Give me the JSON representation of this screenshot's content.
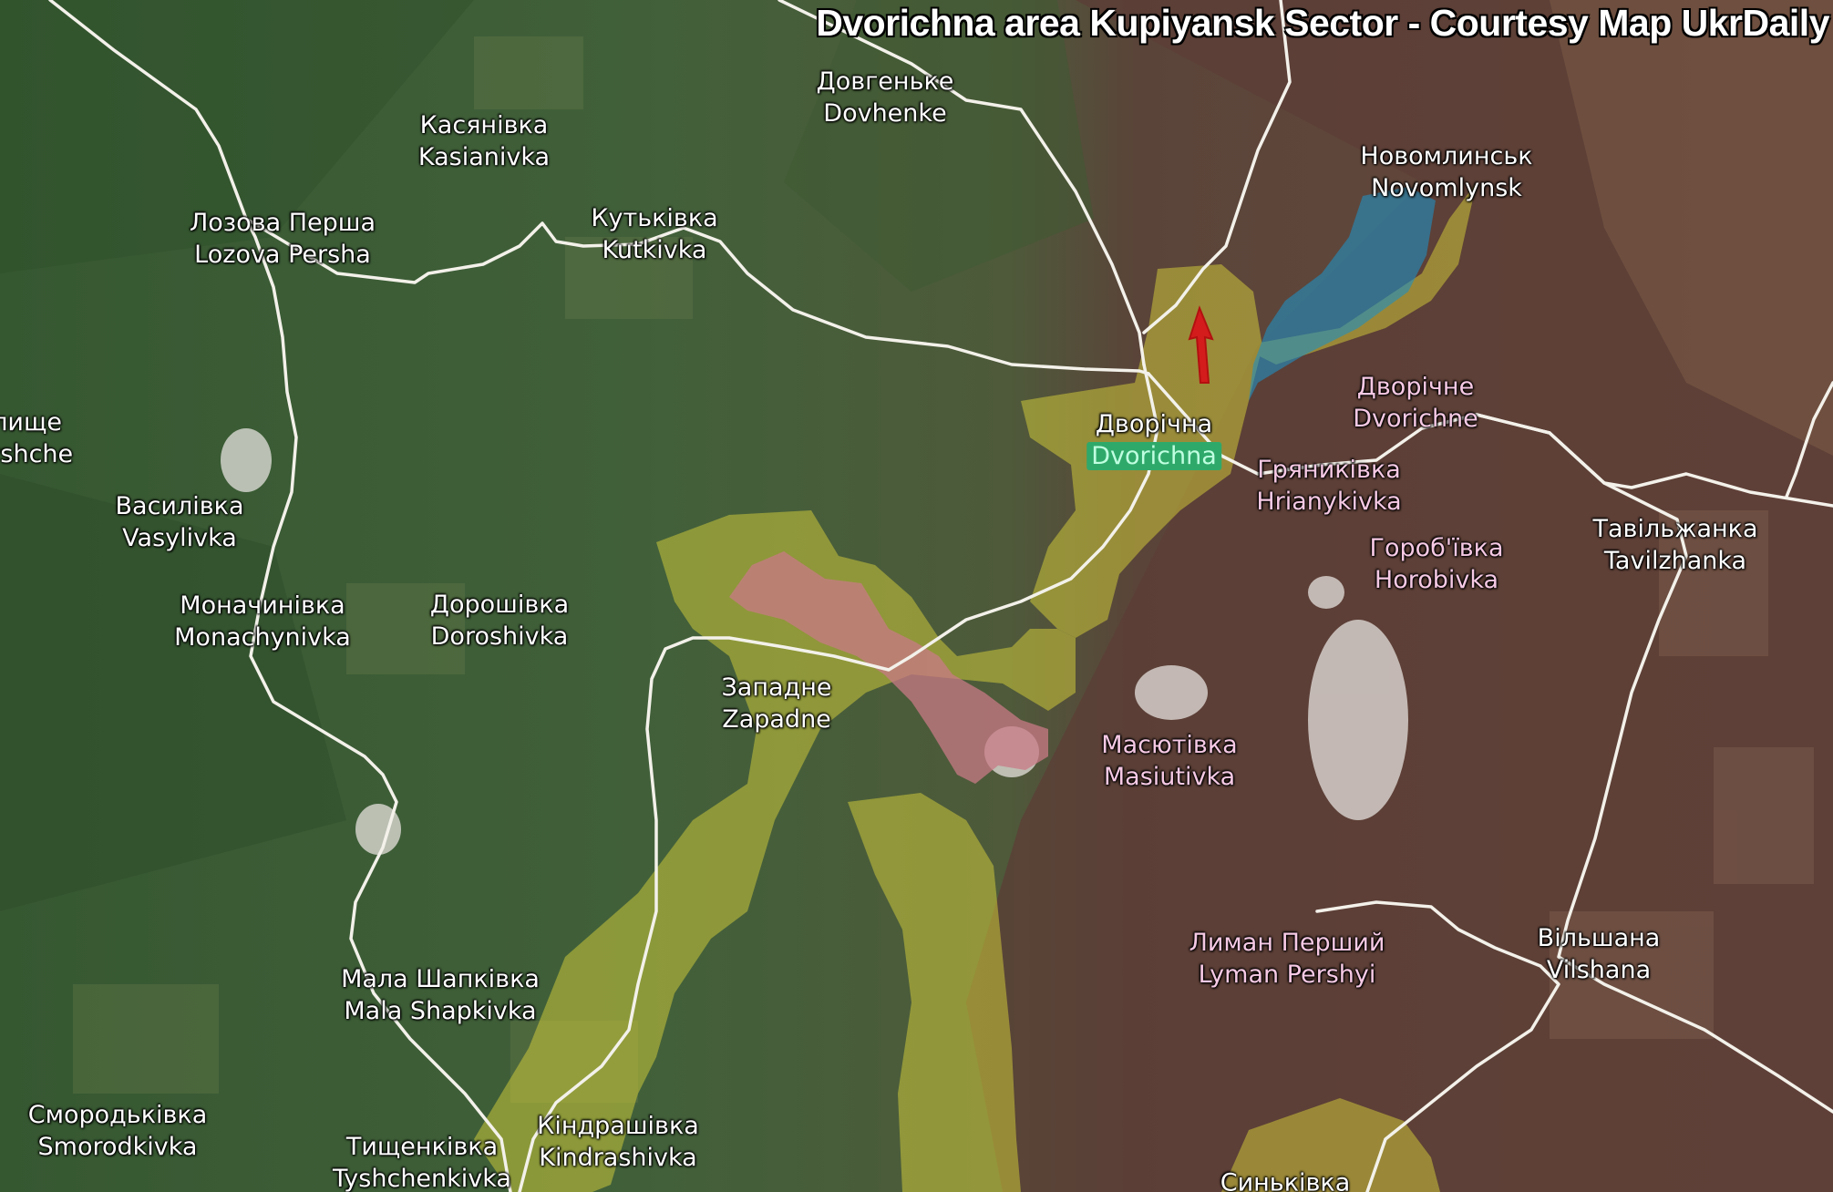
{
  "map": {
    "title": "Dvorichna area Kupiyansk Sector - Courtesy Map UkrDaily",
    "colors": {
      "road": "#f3f1ea",
      "russian_control": "#c87a86",
      "contested": "#d8d23a",
      "river": "#1f8fc1",
      "advance_arrow": "#d41c1c",
      "highlight": "#2fa96a"
    },
    "labels": [
      {
        "id": "dovhenke",
        "uk": "Довгеньке",
        "en": "Dovhenke",
        "style": "white"
      },
      {
        "id": "kasianivka",
        "uk": "Касянівка",
        "en": "Kasianivka",
        "style": "white"
      },
      {
        "id": "lozova-persha",
        "uk": "Лозова Перша",
        "en": "Lozova Persha",
        "style": "white"
      },
      {
        "id": "kutkivka",
        "uk": "Кутьківка",
        "en": "Kutkivka",
        "style": "white"
      },
      {
        "id": "novomlynsk",
        "uk": "Новомлинськ",
        "en": "Novomlynsk",
        "style": "white"
      },
      {
        "id": "velyshche",
        "uk": "Велище",
        "en": "Velyshche",
        "style": "white"
      },
      {
        "id": "dvorichna",
        "uk": "Дворічна",
        "en": "Dvorichna",
        "style": "white",
        "highlight": true
      },
      {
        "id": "dvorichne",
        "uk": "Дворічне",
        "en": "Dvorichne",
        "style": "pink"
      },
      {
        "id": "hrianykivka",
        "uk": "Гряниківка",
        "en": "Hrianykivka",
        "style": "pink"
      },
      {
        "id": "vasylivka",
        "uk": "Василівка",
        "en": "Vasylivka",
        "style": "white"
      },
      {
        "id": "horobivka",
        "uk": "Гороб'ївка",
        "en": "Horobivka",
        "style": "pink"
      },
      {
        "id": "tavilzhanka",
        "uk": "Тавільжанка",
        "en": "Tavilzhanka",
        "style": "white"
      },
      {
        "id": "monachynivka",
        "uk": "Моначинівка",
        "en": "Monachynivka",
        "style": "white"
      },
      {
        "id": "doroshivka",
        "uk": "Дорошівка",
        "en": "Doroshivka",
        "style": "white"
      },
      {
        "id": "zapadne",
        "uk": "Западне",
        "en": "Zapadne",
        "style": "white"
      },
      {
        "id": "masiutivka",
        "uk": "Масютівка",
        "en": "Masiutivka",
        "style": "pink"
      },
      {
        "id": "lyman-pershyi",
        "uk": "Лиман Перший",
        "en": "Lyman Pershyi",
        "style": "pink"
      },
      {
        "id": "vilshana",
        "uk": "Вільшана",
        "en": "Vilshana",
        "style": "white"
      },
      {
        "id": "mala-shapkivka",
        "uk": "Мала Шапківка",
        "en": "Mala Shapkivka",
        "style": "white"
      },
      {
        "id": "smorodkivka",
        "uk": "Смородьківка",
        "en": "Smorodkivka",
        "style": "white"
      },
      {
        "id": "tyshchenkivka",
        "uk": "Тищенківка",
        "en": "Tyshchenkivka",
        "style": "white"
      },
      {
        "id": "kindrashivka",
        "uk": "Кіндрашівка",
        "en": "Kindrashivka",
        "style": "white"
      },
      {
        "id": "synkivka",
        "uk": "Синьківка",
        "en": "",
        "style": "white"
      }
    ]
  }
}
